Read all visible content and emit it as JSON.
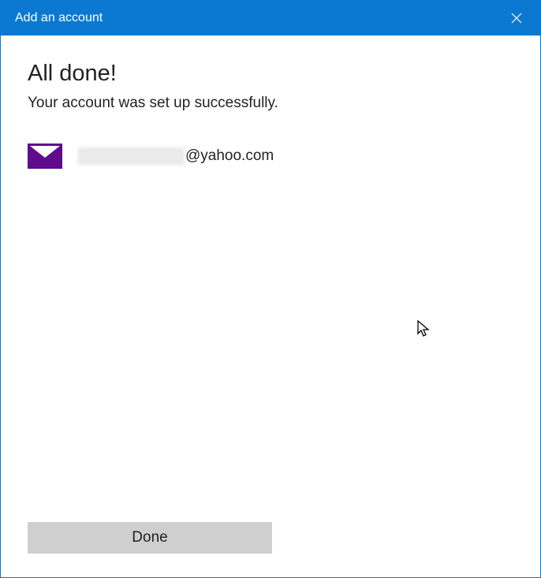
{
  "titlebar": {
    "title": "Add an account"
  },
  "content": {
    "heading": "All done!",
    "subheading": "Your account was set up successfully.",
    "email_domain": "@yahoo.com"
  },
  "footer": {
    "done_label": "Done"
  }
}
